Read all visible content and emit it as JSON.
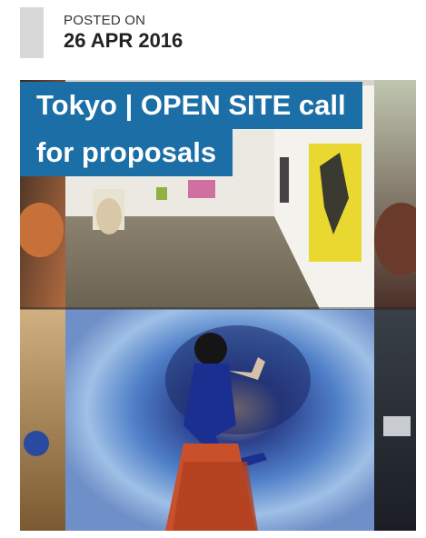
{
  "post": {
    "posted_label": "POSTED ON",
    "date": "26 APR 2016"
  },
  "article": {
    "title_line1": "Tokyo | OPEN SITE call",
    "title_line2": "for proposals",
    "title_bg_color": "#1b6fa6"
  }
}
